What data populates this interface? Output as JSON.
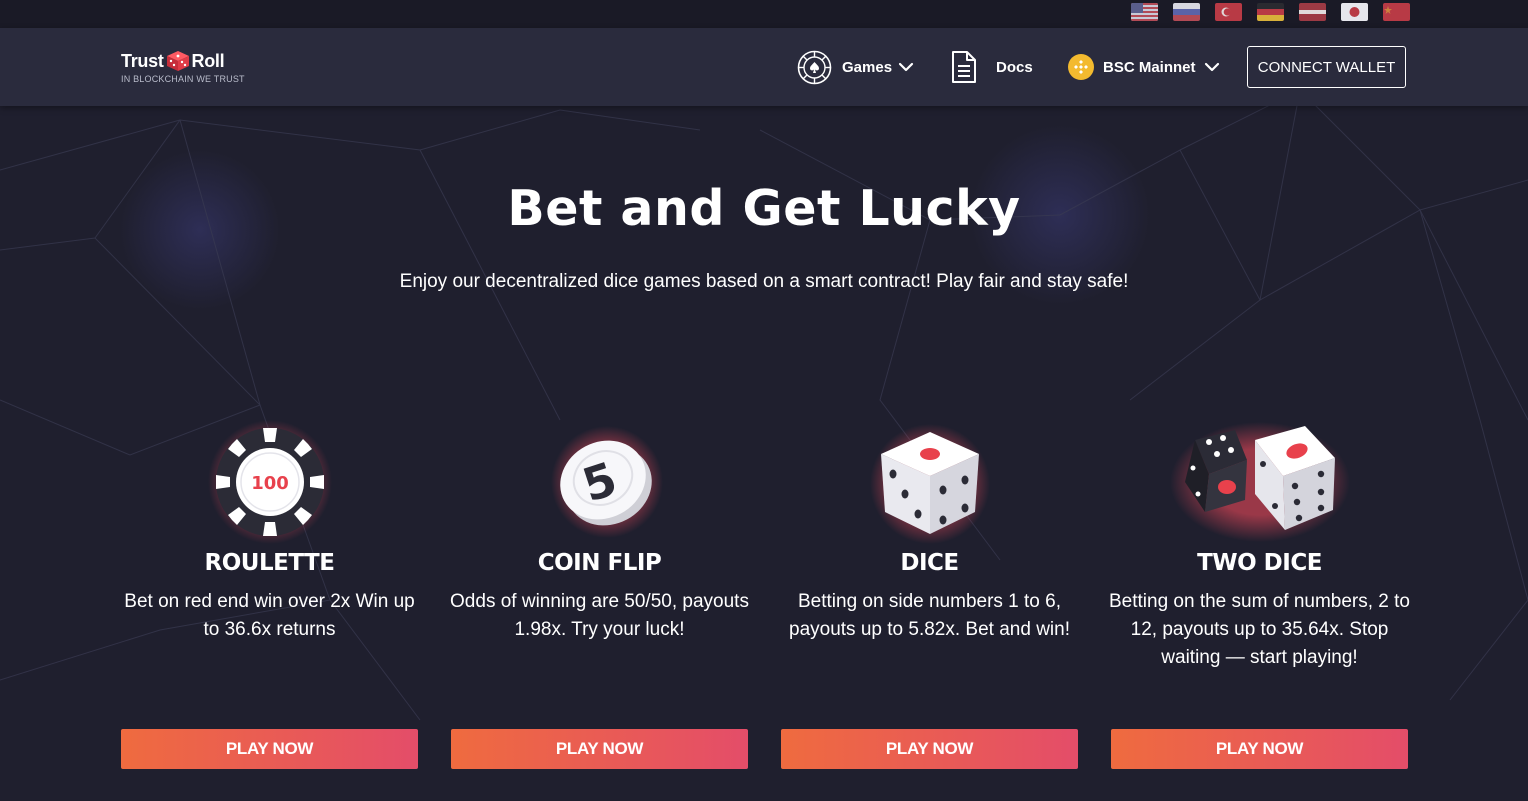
{
  "languages": [
    {
      "code": "en",
      "icon": "flag-us-icon"
    },
    {
      "code": "ru",
      "icon": "flag-ru-icon"
    },
    {
      "code": "tr",
      "icon": "flag-tr-icon"
    },
    {
      "code": "de",
      "icon": "flag-de-icon"
    },
    {
      "code": "lv",
      "icon": "flag-lv-icon"
    },
    {
      "code": "ja",
      "icon": "flag-jp-icon"
    },
    {
      "code": "zh",
      "icon": "flag-cn-icon"
    }
  ],
  "brand": {
    "name_left": "Trust",
    "name_right": "Roll",
    "tagline": "IN BLOCKCHAIN WE TRUST",
    "accent_color": "#e8414c"
  },
  "nav": {
    "games_label": "Games",
    "docs_label": "Docs",
    "network_label": "BSC Mainnet",
    "connect_label": "CONNECT WALLET"
  },
  "hero": {
    "title": "Bet and Get Lucky",
    "subtitle": "Enjoy our decentralized dice games based on a smart contract! Play fair and stay safe!"
  },
  "games": [
    {
      "title": "ROULETTE",
      "icon": "roulette-chip-icon",
      "chip_value": "100",
      "description": "Bet on red end win over 2x Win up to 36.6x returns",
      "button": "PLAY NOW"
    },
    {
      "title": "COIN FLIP",
      "icon": "coin-icon",
      "coin_value": "5",
      "description": "Odds of winning are 50/50, payouts 1.98x. Try your luck!",
      "button": "PLAY NOW"
    },
    {
      "title": "DICE",
      "icon": "dice-icon",
      "description": "Betting on side numbers 1 to 6, payouts up to 5.82x. Bet and win!",
      "button": "PLAY NOW"
    },
    {
      "title": "TWO DICE",
      "icon": "two-dice-icon",
      "description": "Betting on the sum of numbers, 2 to 12, payouts up to 35.64x. Stop waiting — start playing!",
      "button": "PLAY NOW"
    }
  ],
  "colors": {
    "background": "#1f1f2e",
    "header": "#2a2b3d",
    "button_gradient_start": "#ef6b3f",
    "button_gradient_end": "#e44d69",
    "binance_yellow": "#f3ba2f"
  }
}
